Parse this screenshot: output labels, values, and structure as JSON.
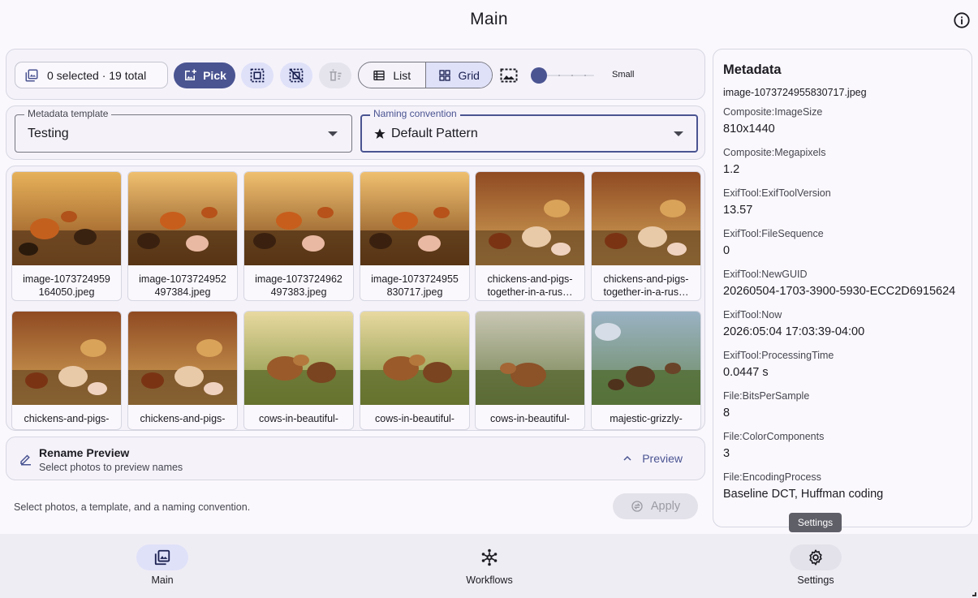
{
  "header": {
    "title": "Main",
    "info_icon": "info-icon"
  },
  "toolbar": {
    "selection_label": "0 selected · 19 total",
    "pick_label": "Pick",
    "view_modes": [
      {
        "label": "List",
        "icon": "list-icon",
        "active": false
      },
      {
        "label": "Grid",
        "icon": "grid-icon",
        "active": true
      }
    ],
    "size_label": "Small",
    "size_level": 0
  },
  "templates": {
    "metadata_template": {
      "label": "Metadata template",
      "value": "Testing"
    },
    "naming_convention": {
      "label": "Naming convention",
      "value": "Default Pattern",
      "icon": "star-icon"
    }
  },
  "gallery": {
    "items": [
      {
        "caption": "image-1073724959\n164050.jpeg",
        "scene": "fox-chickens"
      },
      {
        "caption": "image-1073724952\n497384.jpeg",
        "scene": "fox-pigs"
      },
      {
        "caption": "image-1073724962\n497383.jpeg",
        "scene": "fox-pigs"
      },
      {
        "caption": "image-1073724955\n830717.jpeg",
        "scene": "fox-pigs"
      },
      {
        "caption": "chickens-and-pigs-\ntogether-in-a-rus…",
        "scene": "chickens-pigs"
      },
      {
        "caption": "chickens-and-pigs-\ntogether-in-a-rus…",
        "scene": "chickens-pigs"
      },
      {
        "caption": "chickens-and-pigs-",
        "scene": "chickens-pigs"
      },
      {
        "caption": "chickens-and-pigs-",
        "scene": "chickens-pigs"
      },
      {
        "caption": "cows-in-beautiful-",
        "scene": "cows"
      },
      {
        "caption": "cows-in-beautiful-",
        "scene": "cows"
      },
      {
        "caption": "cows-in-beautiful-",
        "scene": "cows-mist"
      },
      {
        "caption": "majestic-grizzly-",
        "scene": "bears"
      }
    ]
  },
  "rename": {
    "title": "Rename Preview",
    "subtitle": "Select photos to preview names",
    "preview_label": "Preview"
  },
  "footer": {
    "hint": "Select photos, a template, and a naming convention.",
    "apply_label": "Apply"
  },
  "metadata": {
    "title": "Metadata",
    "filename": "image-1073724955830717.jpeg",
    "entries": [
      {
        "key": "Composite:ImageSize",
        "value": "810x1440"
      },
      {
        "key": "Composite:Megapixels",
        "value": "1.2"
      },
      {
        "key": "ExifTool:ExifToolVersion",
        "value": "13.57"
      },
      {
        "key": "ExifTool:FileSequence",
        "value": "0"
      },
      {
        "key": "ExifTool:NewGUID",
        "value": "20260504-1703-3900-5930-ECC2D6915624"
      },
      {
        "key": "ExifTool:Now",
        "value": "2026:05:04 17:03:39-04:00"
      },
      {
        "key": "ExifTool:ProcessingTime",
        "value": "0.0447 s"
      },
      {
        "key": "File:BitsPerSample",
        "value": "8"
      },
      {
        "key": "File:ColorComponents",
        "value": "3"
      },
      {
        "key": "File:EncodingProcess",
        "value": "Baseline DCT, Huffman coding"
      }
    ]
  },
  "tooltip": {
    "text": "Settings"
  },
  "nav": {
    "items": [
      {
        "label": "Main",
        "icon": "photo-library-icon",
        "active": true
      },
      {
        "label": "Workflows",
        "icon": "workflow-hub-icon",
        "active": false
      },
      {
        "label": "Settings",
        "icon": "gear-icon",
        "active": false
      }
    ]
  },
  "colors": {
    "primary": "#4a5491",
    "primary_container": "#dfe1f9",
    "surface": "#fbf8fd"
  }
}
